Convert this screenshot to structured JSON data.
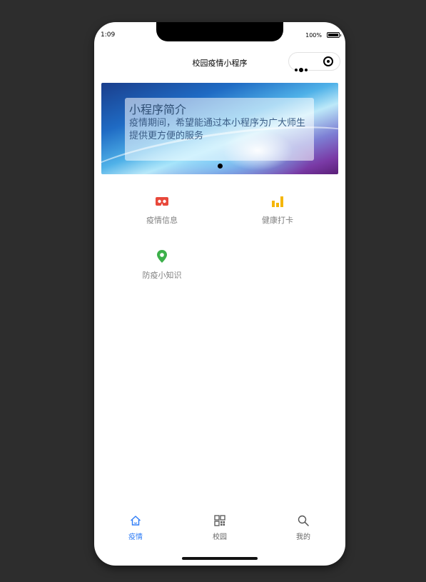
{
  "status_bar": {
    "time": "1:09",
    "battery_percent": "100%",
    "battery_level": 1.0
  },
  "nav": {
    "title": "校园疫情小程序"
  },
  "banner": {
    "title": "小程序简介",
    "text": "疫情期间，希望能通过本小程序为广大师生提供更方便的服务"
  },
  "menu": [
    {
      "label": "疫情信息",
      "icon": "vr-goggles-icon",
      "color": "#e8483b"
    },
    {
      "label": "健康打卡",
      "icon": "bar-chart-icon",
      "color": "#f5b60a"
    },
    {
      "label": "防疫小知识",
      "icon": "location-pin-icon",
      "color": "#3cb04a"
    }
  ],
  "tabbar": {
    "active_color": "#2e7cf6",
    "items": [
      {
        "label": "疫情",
        "icon": "home-icon",
        "active": true
      },
      {
        "label": "校园",
        "icon": "qr-grid-icon",
        "active": false
      },
      {
        "label": "我的",
        "icon": "search-icon",
        "active": false
      }
    ]
  }
}
